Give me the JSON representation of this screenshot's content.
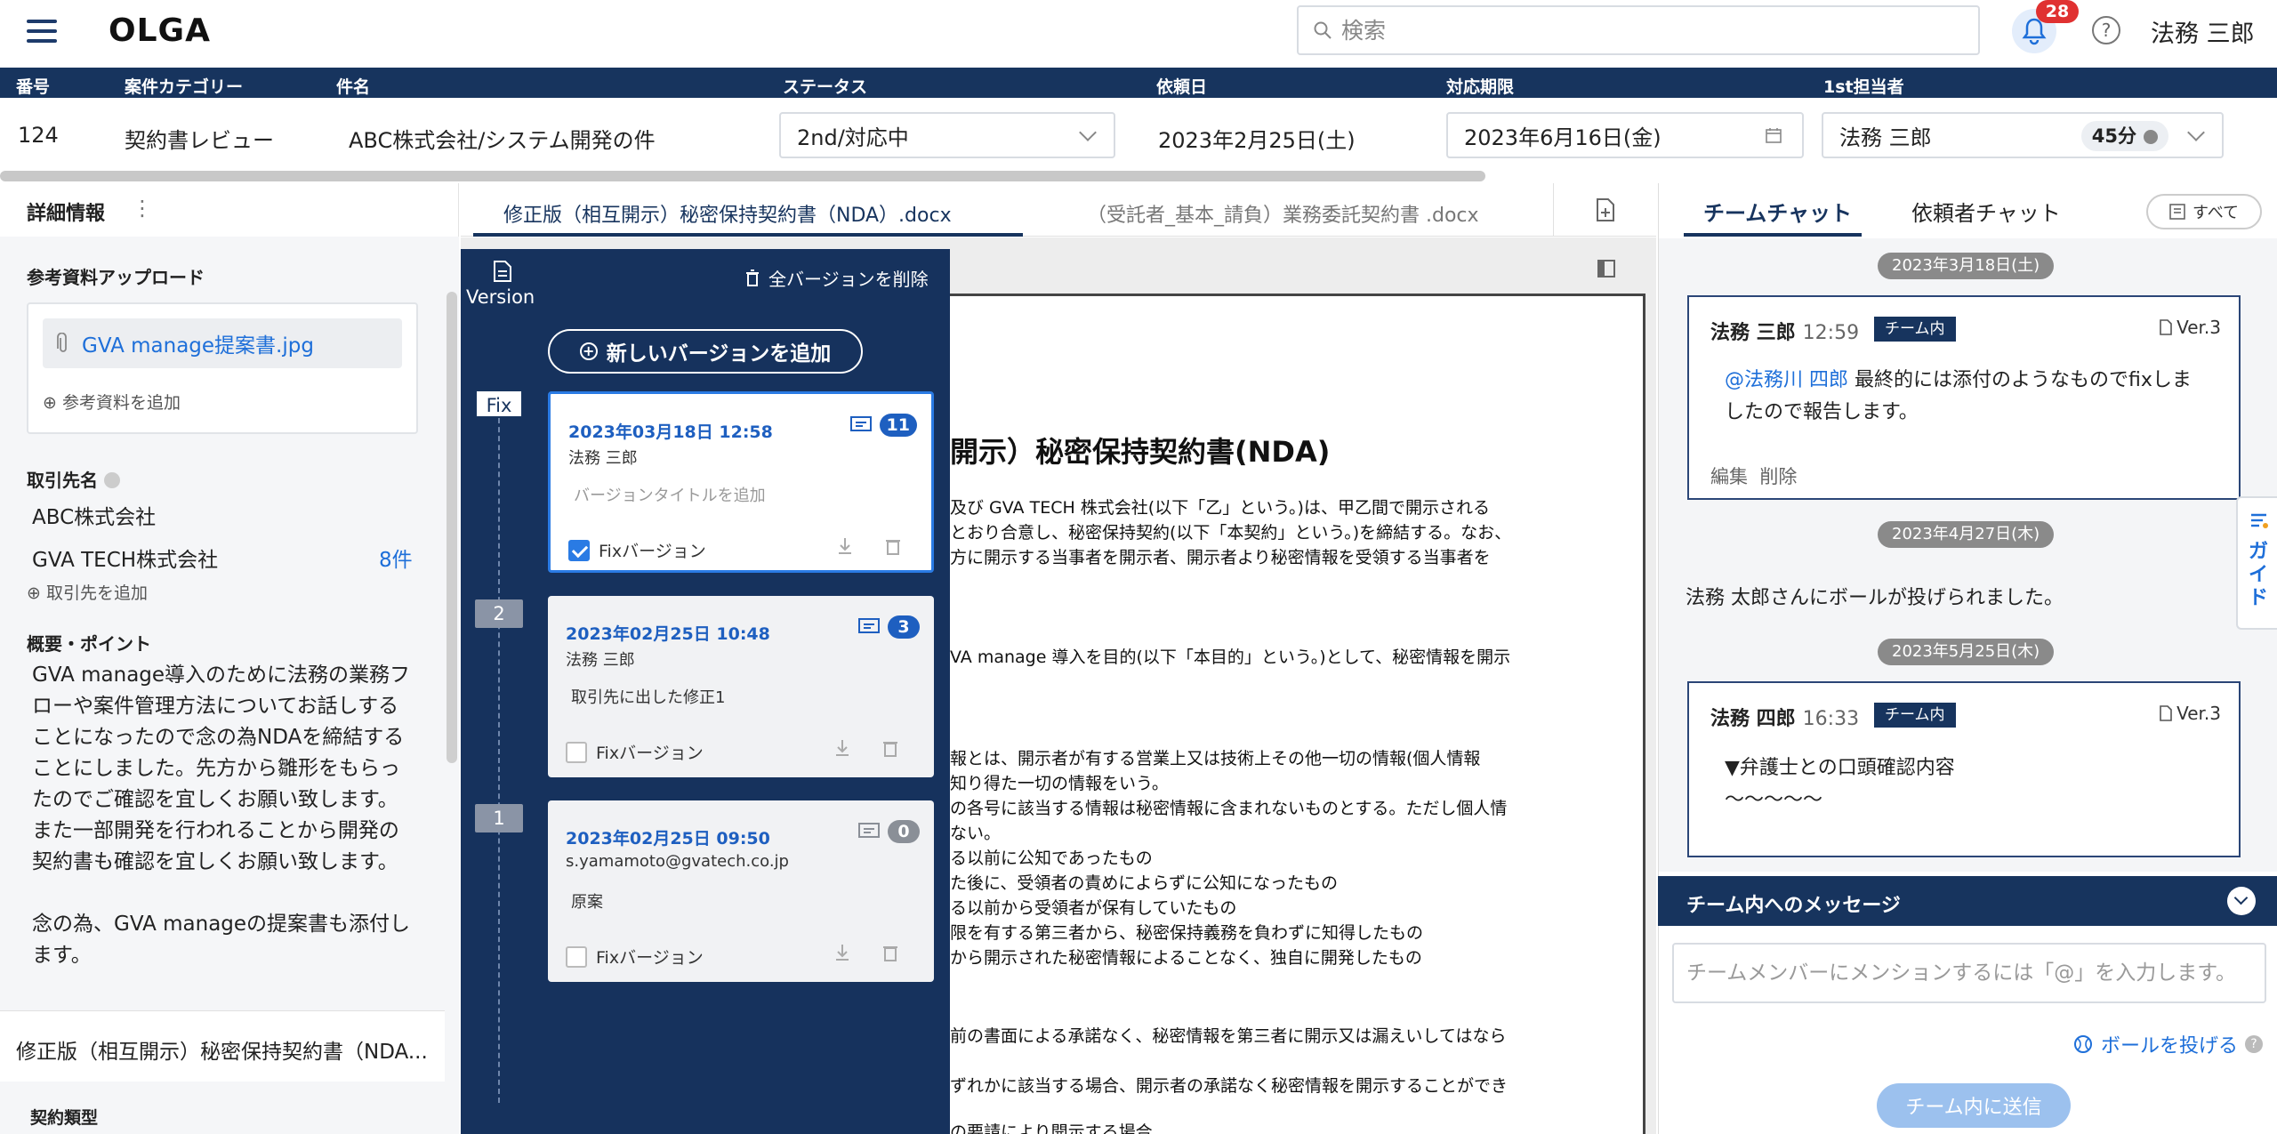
{
  "app": {
    "name": "OLGA"
  },
  "search": {
    "placeholder": "検索"
  },
  "notifications": {
    "count": "28"
  },
  "user": {
    "name": "法務 三郎"
  },
  "case_table": {
    "headers": [
      "番号",
      "案件カテゴリー",
      "件名",
      "ステータス",
      "依頼日",
      "対応期限",
      "1st担当者"
    ],
    "row": {
      "number": "124",
      "category": "契約書レビュー",
      "subject": "ABC株式会社/システム開発の件",
      "status": "2nd/対応中",
      "request_date": "2023年2月25日(土)",
      "deadline": "2023年6月16日(金)",
      "assignee": "法務 三郎",
      "time": "45分"
    }
  },
  "left_panel": {
    "title": "詳細情報",
    "ref_upload_label": "参考資料アップロード",
    "ref_file": "GVA manage提案書.jpg",
    "add_ref": "参考資料を追加",
    "partner_label": "取引先名",
    "partners": [
      {
        "name": "ABC株式会社",
        "count": ""
      },
      {
        "name": "GVA TECH株式会社",
        "count": "8件"
      }
    ],
    "add_partner": "取引先を追加",
    "summary_label": "概要・ポイント",
    "summary_lines": [
      "GVA manage導入のために法務の業務フ",
      "ローや案件管理方法についてお話しする",
      "ことになったので念の為NDAを締結する",
      "ことにしました。先方から雛形をもらっ",
      "たのでご確認を宜しくお願い致します。",
      "また一部開発を行われることから開発の",
      "契約書も確認を宜しくお願い致します。",
      "",
      "念の為、GVA manageの提案書も添付し",
      "ます。"
    ],
    "doc_tab": "修正版（相互開示）秘密保持契約書（NDA...",
    "contract_type_label": "契約類型"
  },
  "doc_tabs": [
    "修正版（相互開示）秘密保持契約書（NDA）.docx",
    "（受託者_基本_請負）業務委託契約書 .docx"
  ],
  "document": {
    "title": "開示）秘密保持契約書(NDA)",
    "lines": [
      "及び GVA TECH 株式会社(以下「乙」という。)は、甲乙間で開示される",
      "とおり合意し、秘密保持契約(以下「本契約」という。)を締結する。なお、",
      "方に開示する当事者を開示者、開示者より秘密情報を受領する当事者を",
      "VA manage 導入を目的(以下「本目的」という。)として、秘密情報を開示",
      "報とは、開示者が有する営業上又は技術上その他一切の情報(個人情報",
      "知り得た一切の情報をいう。",
      "の各号に該当する情報は秘密情報に含まれないものとする。ただし個人情",
      "ない。",
      "る以前に公知であったもの",
      "た後に、受領者の責めによらずに公知になったもの",
      "る以前から受領者が保有していたもの",
      "限を有する第三者から、秘密保持義務を負わずに知得したもの",
      "から開示された秘密情報によることなく、独自に開発したもの",
      "前の書面による承諾なく、秘密情報を第三者に開示又は漏えいしてはなら",
      "ずれかに該当する場合、開示者の承諾なく秘密情報を開示することができ",
      "の要請により開示する場合"
    ]
  },
  "versions": {
    "header_label": "Version",
    "delete_all": "全バージョンを削除",
    "add_new": "新しいバージョンを追加",
    "fix_label": "Fixバージョン",
    "items": [
      {
        "tag": "Fix",
        "date": "2023年03月18日 12:58",
        "user": "法務 三郎",
        "note": "バージョンタイトルを追加",
        "comments": "11",
        "fixed": true
      },
      {
        "tag": "2",
        "date": "2023年02月25日 10:48",
        "user": "法務 三郎",
        "note": "取引先に出した修正1",
        "comments": "3",
        "fixed": false
      },
      {
        "tag": "1",
        "date": "2023年02月25日 09:50",
        "user": "s.yamamoto@gvatech.co.jp",
        "note": "原案",
        "comments": "0",
        "fixed": false
      }
    ]
  },
  "chat": {
    "tabs": [
      "チームチャット",
      "依頼者チャット"
    ],
    "all_button": "すべて",
    "guide": "ガイド",
    "dates": [
      "2023年3月18日(土)",
      "2023年4月27日(木)",
      "2023年5月25日(木)"
    ],
    "messages": [
      {
        "user": "法務 三郎",
        "time": "12:59",
        "tag": "チーム内",
        "version": "Ver.3",
        "mention": "@法務川 四郎",
        "text_line1": " 最終的には添付のようなものでfixしま",
        "text_line2": "したので報告します。",
        "edit": "編集",
        "delete": "削除"
      },
      {
        "user": "法務 四郎",
        "time": "16:33",
        "tag": "チーム内",
        "version": "Ver.3",
        "text_line1": "▼弁護士との口頭確認内容",
        "text_line2": "〜〜〜〜〜"
      }
    ],
    "system_message": "法務 太郎さんにボールが投げられました。",
    "team_bar": "チーム内へのメッセージ",
    "input_placeholder": "チームメンバーにメンションするには「@」を入力します。",
    "throw_ball": "ボールを投げる",
    "send": "チーム内に送信"
  },
  "colors": {
    "navy": "#17345e",
    "accent": "#1e6fd9",
    "badge": "#e03131"
  }
}
